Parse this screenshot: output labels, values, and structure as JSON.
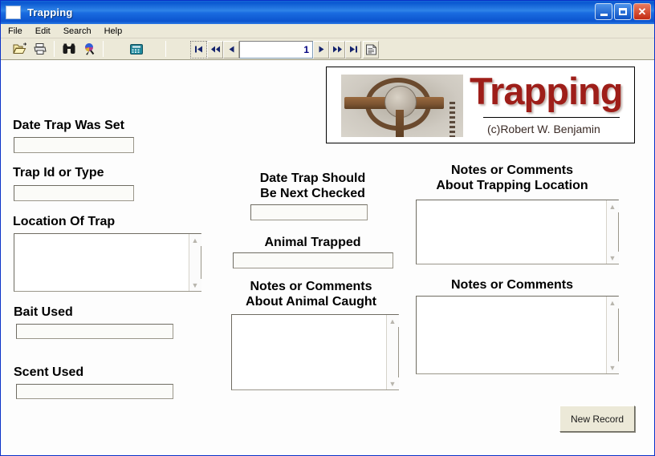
{
  "window": {
    "title": "Trapping",
    "icon": "document-icon",
    "controls": {
      "minimize": "minimize-icon",
      "maximize": "maximize-icon",
      "close": "close-icon"
    }
  },
  "menubar": {
    "items": [
      {
        "label": "File"
      },
      {
        "label": "Edit"
      },
      {
        "label": "Search"
      },
      {
        "label": "Help"
      }
    ]
  },
  "toolbar": {
    "buttons": [
      {
        "name": "open-folder-icon",
        "glyph": "📂"
      },
      {
        "name": "print-icon",
        "glyph": "🖨"
      },
      {
        "name": "binoculars-search-icon",
        "glyph": "🔍"
      },
      {
        "name": "search-replace-icon",
        "glyph": "🌐"
      },
      {
        "name": "calculator-icon",
        "glyph": "🖩"
      }
    ],
    "nav": {
      "first_label": "⏮",
      "prev_page_label": "◀◀",
      "prev_label": "◀",
      "record_value": "1",
      "next_label": "▶",
      "next_page_label": "▶▶",
      "last_label": "⏭",
      "properties_label": "🗒"
    }
  },
  "banner": {
    "title": "Trapping",
    "credit": "(c)Robert W. Benjamin",
    "photo_alt": "leg-hold-trap-photo"
  },
  "form": {
    "date_trap_set": {
      "label": "Date Trap Was Set",
      "value": ""
    },
    "trap_id": {
      "label": "Trap Id or Type",
      "value": ""
    },
    "location_of_trap": {
      "label": "Location Of Trap",
      "value": ""
    },
    "bait_used": {
      "label": "Bait Used",
      "value": ""
    },
    "scent_used": {
      "label": "Scent Used",
      "value": ""
    },
    "date_next_checked": {
      "label_line1": "Date Trap Should",
      "label_line2": "Be Next Checked",
      "value": ""
    },
    "animal_trapped": {
      "label": "Animal Trapped",
      "value": ""
    },
    "notes_animal": {
      "label_line1": "Notes or Comments",
      "label_line2": "About Animal Caught",
      "value": ""
    },
    "notes_location": {
      "label_line1": "Notes or Comments",
      "label_line2": "About Trapping Location",
      "value": ""
    },
    "notes_general": {
      "label": "Notes or Comments",
      "value": ""
    }
  },
  "actions": {
    "new_record": "New Record"
  },
  "colors": {
    "titlebar_blue": "#0a57d0",
    "window_border": "#0a32c8",
    "toolbar_face": "#ece9d8",
    "banner_red": "#9e1e19",
    "nav_arrow_navy": "#0c2a7a"
  }
}
